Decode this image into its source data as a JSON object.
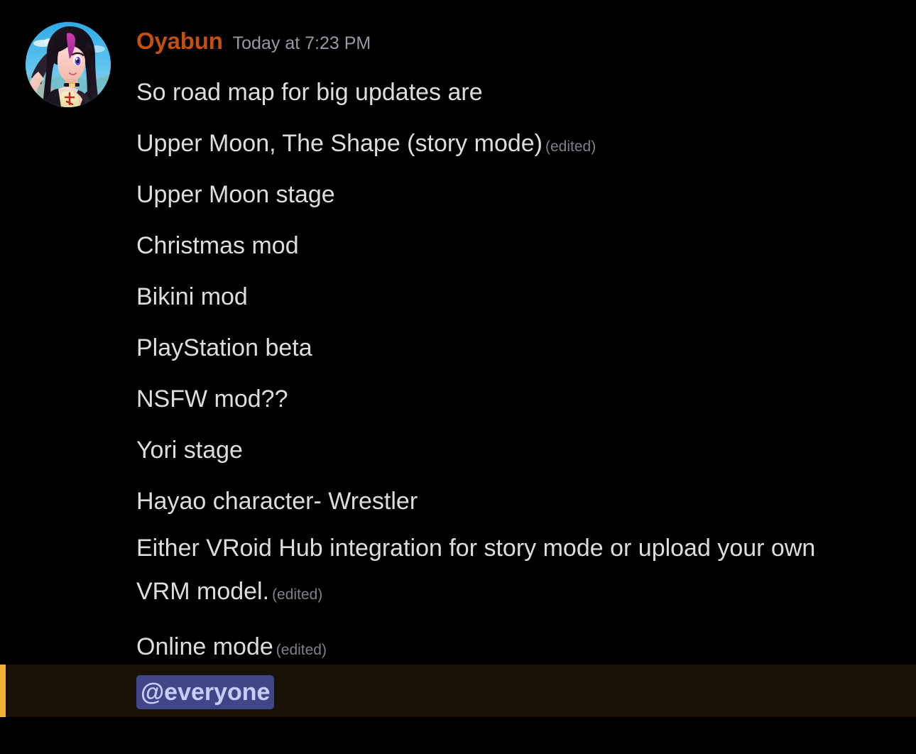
{
  "theme": {
    "background": "#000000",
    "text_color": "#dbdee1",
    "author_color": "#c4500f",
    "timestamp_color": "#949ba4",
    "edited_color": "#7d828a",
    "mention_pill_background": "#414689",
    "mention_pill_text": "#c9cdfb",
    "mention_row_background": "#191106",
    "mention_row_bar": "#f0b232"
  },
  "message": {
    "author": "Oyabun",
    "timestamp": "Today at 7:23 PM",
    "avatar_alt": "anime-avatar",
    "lines": [
      {
        "text": "So road map for big updates are",
        "edited": ""
      },
      {
        "text": "Upper Moon, The Shape (story mode)",
        "edited": "(edited)"
      },
      {
        "text": "Upper Moon stage",
        "edited": ""
      },
      {
        "text": "Christmas mod",
        "edited": ""
      },
      {
        "text": "Bikini mod",
        "edited": ""
      },
      {
        "text": "PlayStation beta",
        "edited": ""
      },
      {
        "text": "NSFW mod??",
        "edited": ""
      },
      {
        "text": "Yori stage",
        "edited": ""
      },
      {
        "text": "Hayao character- Wrestler",
        "edited": ""
      },
      {
        "text": "Either VRoid Hub integration for story mode or upload your own VRM model.",
        "edited": "(edited)"
      },
      {
        "text": "Online mode",
        "edited": "(edited)"
      }
    ],
    "mention": {
      "label": "@everyone"
    }
  }
}
